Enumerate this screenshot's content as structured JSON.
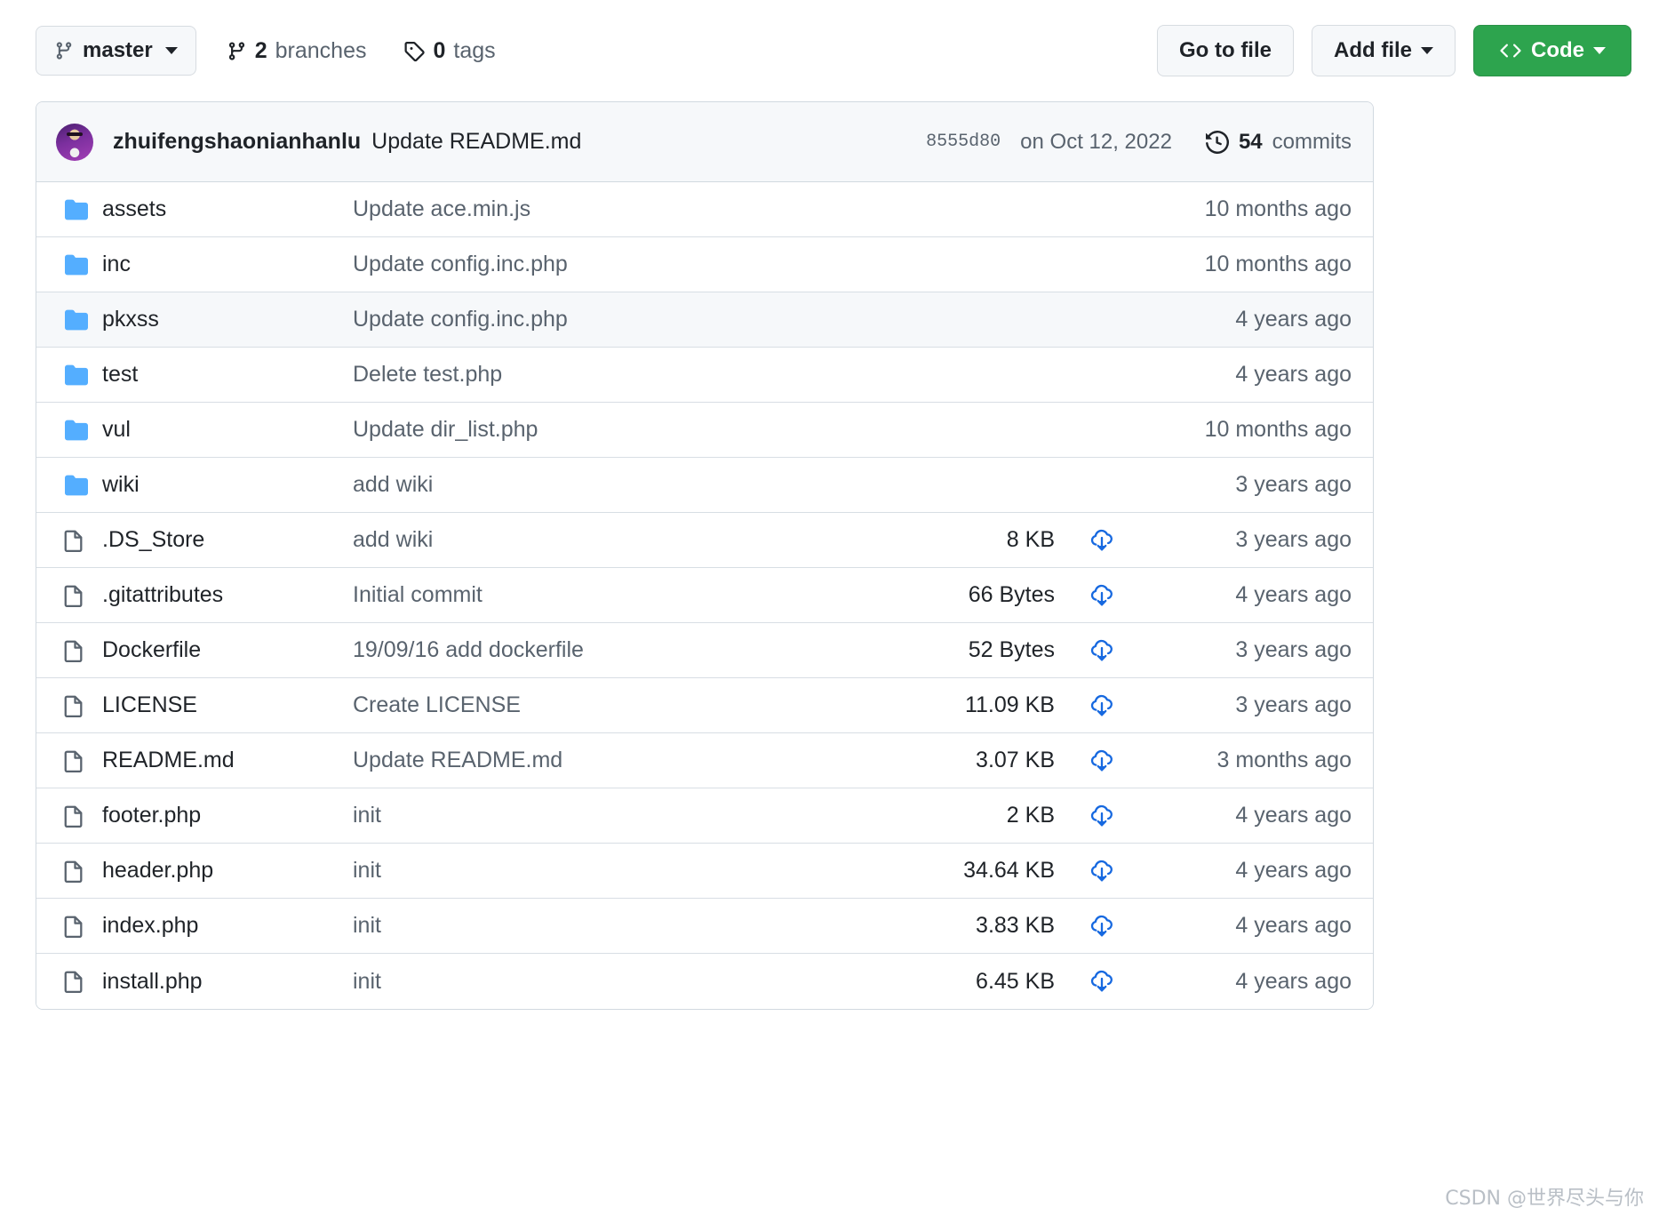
{
  "toolbar": {
    "branch": {
      "name": "master",
      "icon": "branch-icon"
    },
    "branches": {
      "count": "2",
      "label": "branches",
      "icon": "branch-icon"
    },
    "tags": {
      "count": "0",
      "label": "tags",
      "icon": "tag-icon"
    },
    "go_to_file": "Go to file",
    "add_file": "Add file",
    "code": "Code",
    "code_icon": "code-brackets-icon",
    "colors": {
      "code_button_bg": "#2da44e",
      "button_bg": "#f6f8fa",
      "border": "#d7dce1"
    }
  },
  "commit_bar": {
    "avatar": "user-avatar",
    "author": "zhuifengshaonianhanlu",
    "message": "Update README.md",
    "sha": "8555d80",
    "date": "on Oct 12, 2022",
    "history_icon": "history-clock-icon",
    "commits_count": "54",
    "commits_label": "commits"
  },
  "files": [
    {
      "type": "folder",
      "name": "assets",
      "message": "Update ace.min.js",
      "size": "",
      "download": false,
      "age": "10 months ago",
      "alt": false
    },
    {
      "type": "folder",
      "name": "inc",
      "message": "Update config.inc.php",
      "size": "",
      "download": false,
      "age": "10 months ago",
      "alt": false
    },
    {
      "type": "folder",
      "name": "pkxss",
      "message": "Update config.inc.php",
      "size": "",
      "download": false,
      "age": "4 years ago",
      "alt": true
    },
    {
      "type": "folder",
      "name": "test",
      "message": "Delete test.php",
      "size": "",
      "download": false,
      "age": "4 years ago",
      "alt": false
    },
    {
      "type": "folder",
      "name": "vul",
      "message": "Update dir_list.php",
      "size": "",
      "download": false,
      "age": "10 months ago",
      "alt": false
    },
    {
      "type": "folder",
      "name": "wiki",
      "message": "add wiki",
      "size": "",
      "download": false,
      "age": "3 years ago",
      "alt": false
    },
    {
      "type": "file",
      "name": ".DS_Store",
      "message": "add wiki",
      "size": "8 KB",
      "download": true,
      "age": "3 years ago",
      "alt": false
    },
    {
      "type": "file",
      "name": ".gitattributes",
      "message": "Initial commit",
      "size": "66 Bytes",
      "download": true,
      "age": "4 years ago",
      "alt": false
    },
    {
      "type": "file",
      "name": "Dockerfile",
      "message": "19/09/16 add dockerfile",
      "size": "52 Bytes",
      "download": true,
      "age": "3 years ago",
      "alt": false
    },
    {
      "type": "file",
      "name": "LICENSE",
      "message": "Create LICENSE",
      "size": "11.09 KB",
      "download": true,
      "age": "3 years ago",
      "alt": false
    },
    {
      "type": "file",
      "name": "README.md",
      "message": "Update README.md",
      "size": "3.07 KB",
      "download": true,
      "age": "3 months ago",
      "alt": false
    },
    {
      "type": "file",
      "name": "footer.php",
      "message": "init",
      "size": "2 KB",
      "download": true,
      "age": "4 years ago",
      "alt": false
    },
    {
      "type": "file",
      "name": "header.php",
      "message": "init",
      "size": "34.64 KB",
      "download": true,
      "age": "4 years ago",
      "alt": false
    },
    {
      "type": "file",
      "name": "index.php",
      "message": "init",
      "size": "3.83 KB",
      "download": true,
      "age": "4 years ago",
      "alt": false
    },
    {
      "type": "file",
      "name": "install.php",
      "message": "init",
      "size": "6.45 KB",
      "download": true,
      "age": "4 years ago",
      "alt": false
    }
  ],
  "icons": {
    "folder_color": "#54aeff",
    "file_color": "#59636e",
    "download_color": "#1769e0",
    "folder": "folder-icon",
    "file": "file-icon",
    "download": "cloud-download-icon"
  },
  "watermark": "CSDN @世界尽头与你"
}
